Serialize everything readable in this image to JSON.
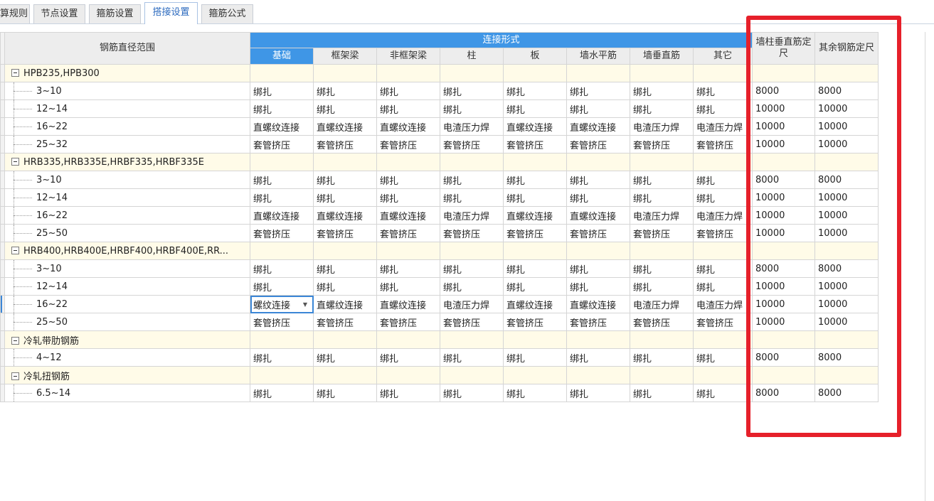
{
  "tabs": [
    {
      "label": "计算规则",
      "active": false
    },
    {
      "label": "节点设置",
      "active": false
    },
    {
      "label": "箍筋设置",
      "active": false
    },
    {
      "label": "搭接设置",
      "active": true
    },
    {
      "label": "箍筋公式",
      "active": false
    }
  ],
  "grid": {
    "header": {
      "diameter_range": "钢筋直径范围",
      "connection_form": "连接形式",
      "columns": [
        "基础",
        "框架梁",
        "非框架梁",
        "柱",
        "板",
        "墙水平筋",
        "墙垂直筋",
        "其它"
      ],
      "wall_col_vertical_length": "墙柱垂直筋定尺",
      "other_rebar_length": "其余钢筋定尺"
    },
    "groups": [
      {
        "name": "HPB235,HPB300",
        "rows": [
          {
            "range": "3~10",
            "cells": [
              "绑扎",
              "绑扎",
              "绑扎",
              "绑扎",
              "绑扎",
              "绑扎",
              "绑扎",
              "绑扎"
            ],
            "len1": "8000",
            "len2": "8000"
          },
          {
            "range": "12~14",
            "cells": [
              "绑扎",
              "绑扎",
              "绑扎",
              "绑扎",
              "绑扎",
              "绑扎",
              "绑扎",
              "绑扎"
            ],
            "len1": "10000",
            "len2": "10000"
          },
          {
            "range": "16~22",
            "cells": [
              "直螺纹连接",
              "直螺纹连接",
              "直螺纹连接",
              "电渣压力焊",
              "直螺纹连接",
              "直螺纹连接",
              "电渣压力焊",
              "电渣压力焊"
            ],
            "len1": "10000",
            "len2": "10000"
          },
          {
            "range": "25~32",
            "cells": [
              "套管挤压",
              "套管挤压",
              "套管挤压",
              "套管挤压",
              "套管挤压",
              "套管挤压",
              "套管挤压",
              "套管挤压"
            ],
            "len1": "10000",
            "len2": "10000"
          }
        ]
      },
      {
        "name": "HRB335,HRB335E,HRBF335,HRBF335E",
        "rows": [
          {
            "range": "3~10",
            "cells": [
              "绑扎",
              "绑扎",
              "绑扎",
              "绑扎",
              "绑扎",
              "绑扎",
              "绑扎",
              "绑扎"
            ],
            "len1": "8000",
            "len2": "8000"
          },
          {
            "range": "12~14",
            "cells": [
              "绑扎",
              "绑扎",
              "绑扎",
              "绑扎",
              "绑扎",
              "绑扎",
              "绑扎",
              "绑扎"
            ],
            "len1": "10000",
            "len2": "10000"
          },
          {
            "range": "16~22",
            "cells": [
              "直螺纹连接",
              "直螺纹连接",
              "直螺纹连接",
              "电渣压力焊",
              "直螺纹连接",
              "直螺纹连接",
              "电渣压力焊",
              "电渣压力焊"
            ],
            "len1": "10000",
            "len2": "10000"
          },
          {
            "range": "25~50",
            "cells": [
              "套管挤压",
              "套管挤压",
              "套管挤压",
              "套管挤压",
              "套管挤压",
              "套管挤压",
              "套管挤压",
              "套管挤压"
            ],
            "len1": "10000",
            "len2": "10000"
          }
        ]
      },
      {
        "name": "HRB400,HRB400E,HRBF400,HRBF400E,RR...",
        "rows": [
          {
            "range": "3~10",
            "cells": [
              "绑扎",
              "绑扎",
              "绑扎",
              "绑扎",
              "绑扎",
              "绑扎",
              "绑扎",
              "绑扎"
            ],
            "len1": "8000",
            "len2": "8000"
          },
          {
            "range": "12~14",
            "cells": [
              "绑扎",
              "绑扎",
              "绑扎",
              "绑扎",
              "绑扎",
              "绑扎",
              "绑扎",
              "绑扎"
            ],
            "len1": "10000",
            "len2": "10000"
          },
          {
            "range": "16~22",
            "cells": [
              "螺纹连接",
              "直螺纹连接",
              "直螺纹连接",
              "电渣压力焊",
              "直螺纹连接",
              "直螺纹连接",
              "电渣压力焊",
              "电渣压力焊"
            ],
            "len1": "10000",
            "len2": "10000",
            "selected": true
          },
          {
            "range": "25~50",
            "cells": [
              "套管挤压",
              "套管挤压",
              "套管挤压",
              "套管挤压",
              "套管挤压",
              "套管挤压",
              "套管挤压",
              "套管挤压"
            ],
            "len1": "10000",
            "len2": "10000"
          }
        ]
      },
      {
        "name": "冷轧带肋钢筋",
        "rows": [
          {
            "range": "4~12",
            "cells": [
              "绑扎",
              "绑扎",
              "绑扎",
              "绑扎",
              "绑扎",
              "绑扎",
              "绑扎",
              "绑扎"
            ],
            "len1": "8000",
            "len2": "8000"
          }
        ]
      },
      {
        "name": "冷轧扭钢筋",
        "rows": [
          {
            "range": "6.5~14",
            "cells": [
              "绑扎",
              "绑扎",
              "绑扎",
              "绑扎",
              "绑扎",
              "绑扎",
              "绑扎",
              "绑扎"
            ],
            "len1": "8000",
            "len2": "8000"
          }
        ]
      }
    ]
  },
  "colors": {
    "header_accent": "#3f96e6",
    "group_row_bg": "#fffbe8",
    "highlight_box": "#e6202a",
    "active_tab_text": "#2d6bbf"
  }
}
